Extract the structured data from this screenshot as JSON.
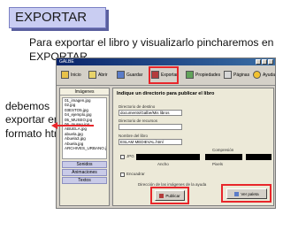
{
  "badge_title": "EXPORTAR",
  "intro_text": "Para exportar el libro y visualizarlo pincharemos en EXPORTAR",
  "side_text": "debemos exportar en formato html",
  "window": {
    "title": "GALBE",
    "toolbar": [
      {
        "label": "Inicio",
        "icon": "home-icon"
      },
      {
        "label": "Abrir",
        "icon": "folder-icon"
      },
      {
        "label": "Guardar",
        "icon": "save-icon"
      },
      {
        "label": "Exportar",
        "icon": "export-icon"
      },
      {
        "label": "Propiedades",
        "icon": "properties-icon"
      },
      {
        "label": "Páginas",
        "icon": "pages-icon"
      },
      {
        "label": "Ayuda",
        "icon": "help-icon"
      }
    ],
    "left_panel": {
      "header": "Imágenes",
      "items": [
        "01_imagen.jpg",
        "02.jpg",
        "03ESTO5.jpg",
        "04_ejemplo.jpg",
        "05_MUSEO.jpg",
        "06_museo.jpg",
        "ABUELA.jpg",
        "abuela.jpg",
        "Abuela3.jpg",
        "Abuela.jpg",
        "ARCHIVES_URBANO.jpg"
      ],
      "tabs": [
        "Sonidos",
        "Animaciones",
        "Textos"
      ]
    },
    "main": {
      "title": "Indique un directorio para publicar el libro",
      "dest_label": "Directorio de destino",
      "dest_value": "documents/Galbe/Mis libros",
      "resources_label": "Directorio de recursos",
      "html_label": "Nombre del libro",
      "html_value": "ESLAM MEDIEVAL.html",
      "compression_label": "Compresión",
      "width_label": "Ancho",
      "height_label": "Pixels",
      "jpg_label": "JPG",
      "check_label": "Encuadrar",
      "preview_label": "Dirección de las imágenes de la ayuda",
      "publish_button": "Publicar",
      "back_button": "Ver paleta"
    }
  },
  "colors": {
    "highlight": "#e8262b",
    "badge_bg": "#c9cdf2"
  }
}
